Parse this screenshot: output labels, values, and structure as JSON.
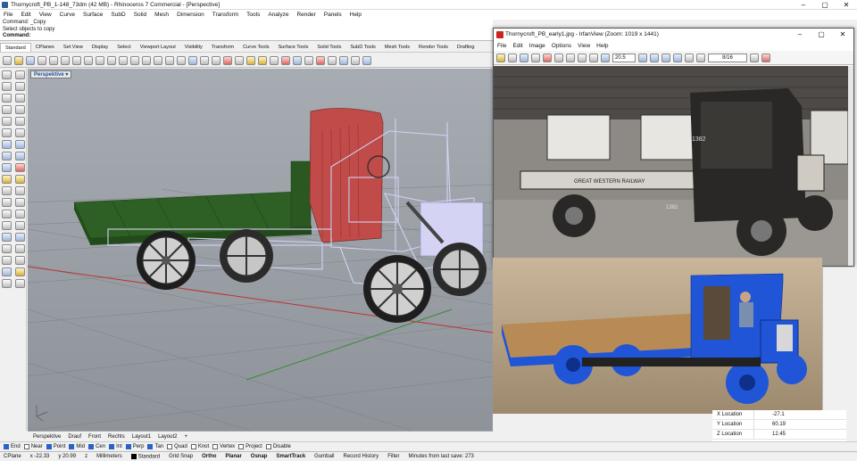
{
  "app": {
    "title": "Thornycroft_PB_1-148_73dm (42 MB) - Rhinoceros 7 Commercial - [Perspective]",
    "menu": [
      "File",
      "Edit",
      "View",
      "Curve",
      "Surface",
      "SubD",
      "Solid",
      "Mesh",
      "Dimension",
      "Transform",
      "Tools",
      "Analyze",
      "Render",
      "Panels",
      "Help"
    ]
  },
  "command": {
    "history1": "Command: _Copy",
    "history2": "Select objects to copy",
    "prompt": "Command:"
  },
  "tabs": [
    "Standard",
    "CPlanes",
    "Set View",
    "Display",
    "Select",
    "Viewport Layout",
    "Visibility",
    "Transform",
    "Curve Tools",
    "Surface Tools",
    "Solid Tools",
    "SubD Tools",
    "Mesh Tools",
    "Render Tools",
    "Drafting"
  ],
  "viewport": {
    "label": "Perspektive",
    "dropdown": "▾"
  },
  "viewtabs": [
    "Perspektive",
    "Drauf",
    "Front",
    "Rechts",
    "Layout1",
    "Layout2",
    "+"
  ],
  "osnaps": [
    {
      "label": "End",
      "on": true
    },
    {
      "label": "Near",
      "on": false
    },
    {
      "label": "Point",
      "on": true
    },
    {
      "label": "Mid",
      "on": true
    },
    {
      "label": "Cen",
      "on": true
    },
    {
      "label": "Int",
      "on": true
    },
    {
      "label": "Perp",
      "on": true
    },
    {
      "label": "Tan",
      "on": true
    },
    {
      "label": "Quad",
      "on": false
    },
    {
      "label": "Knot",
      "on": false
    },
    {
      "label": "Vertex",
      "on": false
    },
    {
      "label": "Project",
      "on": false
    },
    {
      "label": "Disable",
      "on": false
    }
  ],
  "status": {
    "cplane": "CPlane",
    "x": "x -22.33",
    "y": "y 20.99",
    "z": "z",
    "units": "Millimeters",
    "layer": "Standard",
    "gridsnap": "Grid Snap",
    "ortho": "Ortho",
    "planar": "Planar",
    "osnap": "Osnap",
    "smarttrack": "SmartTrack",
    "gumball": "Gumball",
    "record": "Record History",
    "filter": "Filter",
    "autosave": "Minutes from last save: 273"
  },
  "irfan": {
    "title": "Thornycroft_PB_early1.jpg - IrfanView (Zoom: 1019 x 1441)",
    "menu": [
      "File",
      "Edit",
      "Image",
      "Options",
      "View",
      "Help"
    ],
    "zoom": "20.5",
    "page": "8/16",
    "photo_text1": "1382",
    "photo_text2": "GREAT    WESTERN    RAILWAY",
    "photo_text3": "1382"
  },
  "properties": [
    {
      "label": "X Location",
      "value": "-27.1"
    },
    {
      "label": "Y Location",
      "value": "60.19"
    },
    {
      "label": "Z Location",
      "value": "12.45"
    }
  ],
  "colors": {
    "body_red": "#c04b48",
    "bed_green": "#2e5f24",
    "ghost": "#c9c8ef",
    "viewport_bg": "#9aa0a7",
    "model_blue": "#1f55d6"
  }
}
